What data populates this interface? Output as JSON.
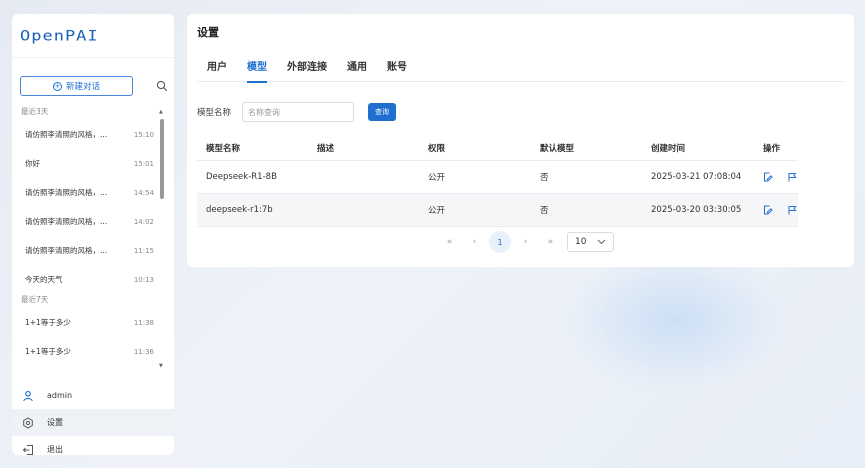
{
  "app": {
    "logo": "OpenPAI"
  },
  "sidebar": {
    "new_chat": "新建对话",
    "groups": [
      {
        "label": "最近3天",
        "items": [
          {
            "title": "请仿照李清照的风格，...",
            "time": "15:10"
          },
          {
            "title": "你好",
            "time": "15:01"
          },
          {
            "title": "请仿照李清照的风格，...",
            "time": "14:54"
          },
          {
            "title": "请仿照李清照的风格，...",
            "time": "14:02"
          },
          {
            "title": "请仿照李清照的风格，...",
            "time": "11:15"
          },
          {
            "title": "今天的天气",
            "time": "10:13"
          }
        ]
      },
      {
        "label": "最近7天",
        "items": [
          {
            "title": "1+1等于多少",
            "time": "11:38"
          },
          {
            "title": "1+1等于多少",
            "time": "11:36"
          }
        ]
      }
    ],
    "menu": {
      "user": "admin",
      "settings": "设置",
      "logout": "退出"
    }
  },
  "main": {
    "title": "设置",
    "tabs": [
      "用户",
      "模型",
      "外部连接",
      "通用",
      "账号"
    ],
    "active_tab": 1,
    "filter": {
      "label": "模型名称",
      "placeholder": "名称查询",
      "value": "",
      "button": "查询"
    },
    "table": {
      "headers": [
        "模型名称",
        "描述",
        "权限",
        "默认模型",
        "创建时间",
        "操作"
      ],
      "rows": [
        {
          "name": "Deepseek-R1-8B",
          "desc": "",
          "perm": "公开",
          "default": "否",
          "created": "2025-03-21 07:08:04"
        },
        {
          "name": "deepseek-r1:7b",
          "desc": "",
          "perm": "公开",
          "default": "否",
          "created": "2025-03-20 03:30:05"
        }
      ]
    },
    "pagination": {
      "current": "1",
      "page_size": "10",
      "first": "«",
      "prev": "‹",
      "next": "›",
      "last": "»"
    }
  },
  "colors": {
    "accent": "#1f6fd1",
    "logo": "#1a5fb4"
  }
}
